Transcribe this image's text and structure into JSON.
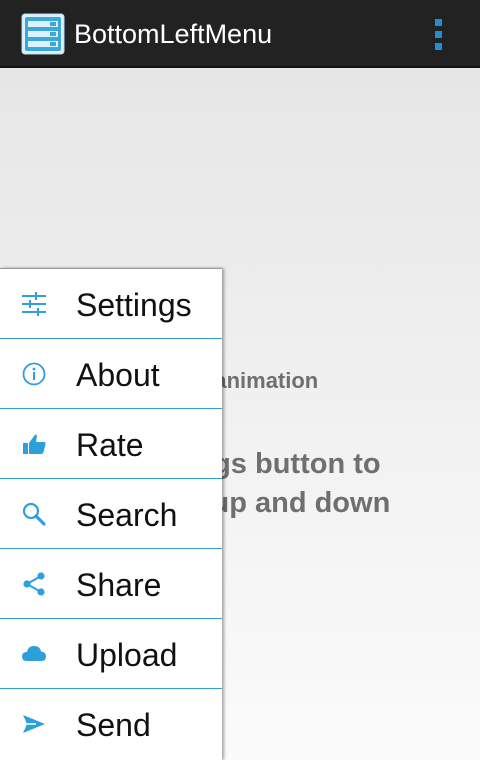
{
  "app": {
    "title": "BottomLeftMenu",
    "icon": "menu-list-icon",
    "overflow_icon": "overflow-menu-icon"
  },
  "content": {
    "subtitle": "k animation",
    "instructions": "ttings button to\nnu up and down"
  },
  "menu": {
    "items": [
      {
        "label": "Settings",
        "icon": "sliders-icon"
      },
      {
        "label": "About",
        "icon": "info-icon"
      },
      {
        "label": "Rate",
        "icon": "thumbs-up-icon"
      },
      {
        "label": "Search",
        "icon": "search-icon"
      },
      {
        "label": "Share",
        "icon": "share-icon"
      },
      {
        "label": "Upload",
        "icon": "cloud-icon"
      },
      {
        "label": "Send",
        "icon": "send-icon"
      }
    ]
  },
  "colors": {
    "action_bar": "#222222",
    "accent": "#33a2cf",
    "icon_blue": "#2ea0d9",
    "text_gray": "#6f6f6f"
  }
}
